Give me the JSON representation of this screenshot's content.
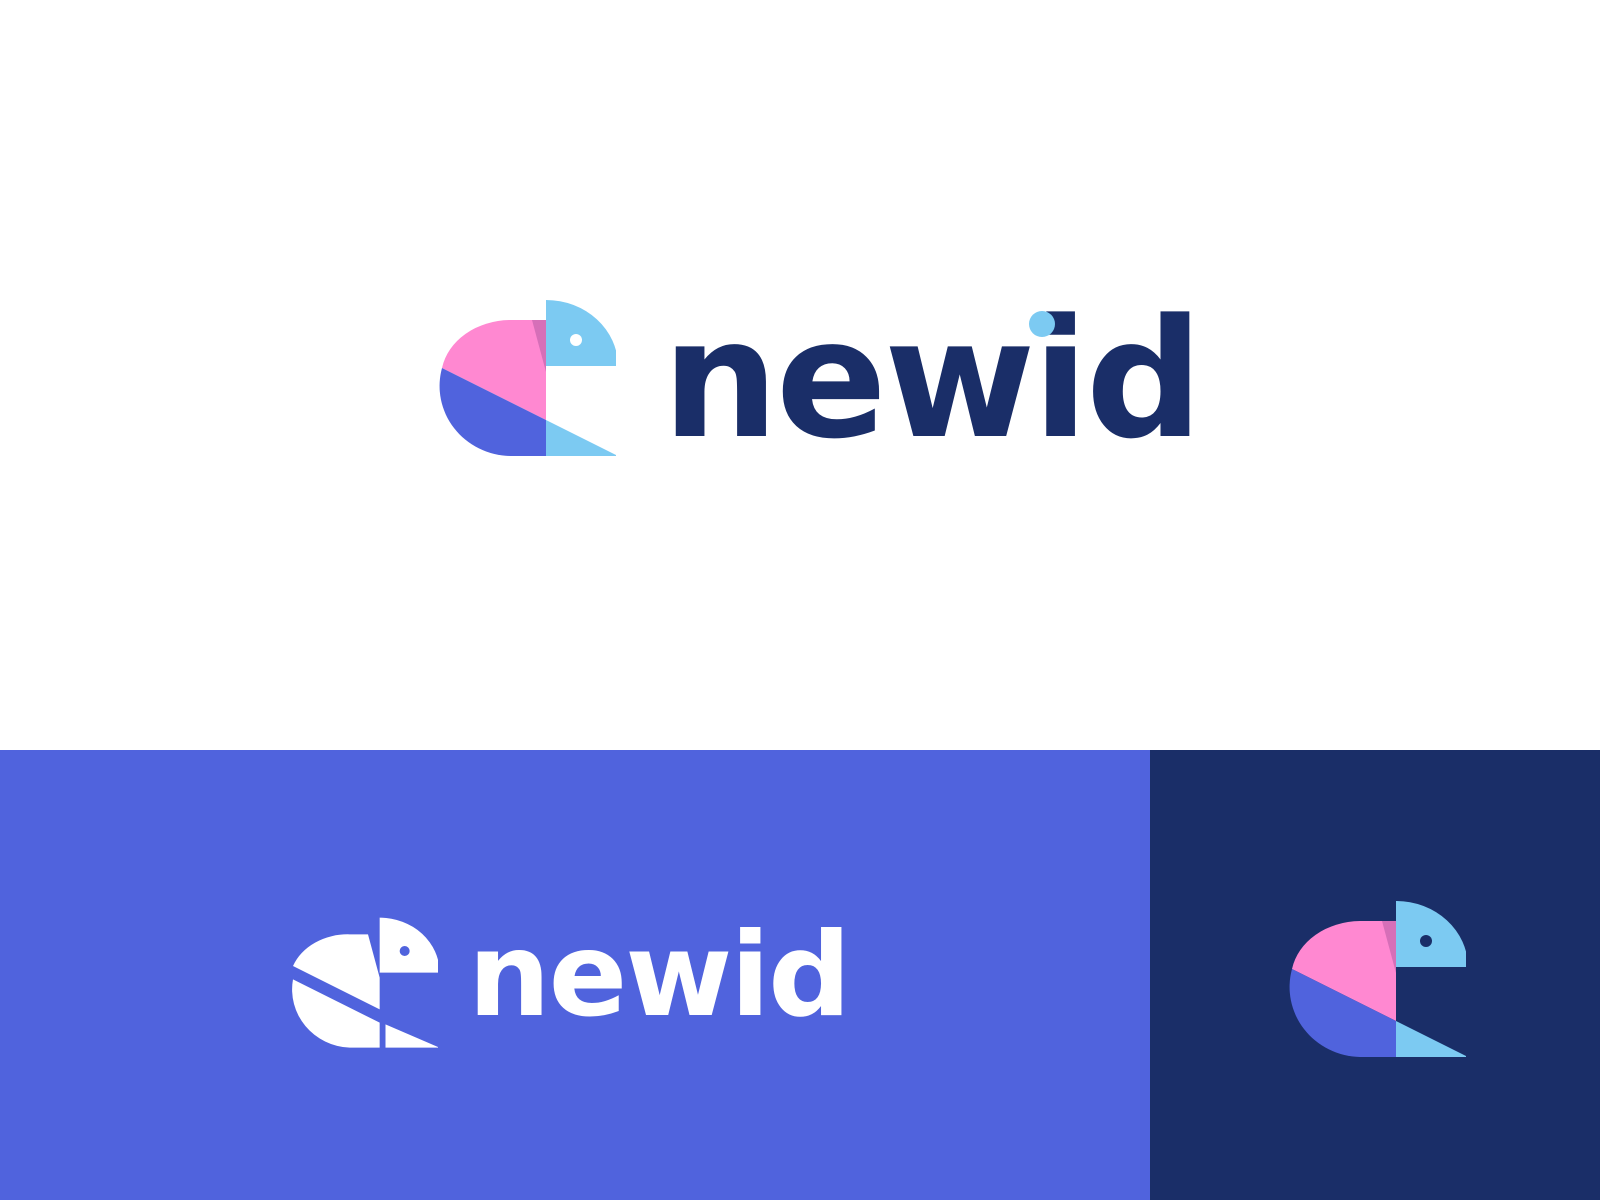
{
  "brand": {
    "name": "newid",
    "colors": {
      "navy": "#1a2e68",
      "royal_blue": "#5063dd",
      "pink": "#ff88d1",
      "sky_blue": "#7ccaf2",
      "magenta_overlap": "#d66fb8",
      "white": "#ffffff"
    }
  },
  "sections": [
    {
      "id": "light",
      "background": "#ffffff",
      "variant": "full-color logo with navy wordmark"
    },
    {
      "id": "blue",
      "background": "#5063dd",
      "variant": "white monochrome logo with white wordmark"
    },
    {
      "id": "navy",
      "background": "#1a2e68",
      "variant": "full-color bird icon only"
    }
  ],
  "icon": {
    "name": "parrot-bird-icon"
  }
}
